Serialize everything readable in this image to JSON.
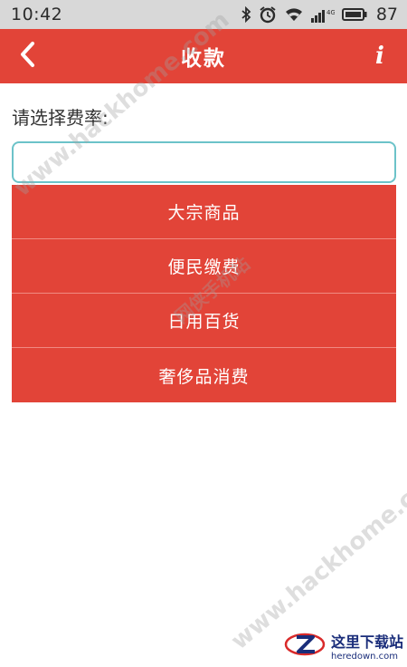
{
  "status_bar": {
    "time": "10:42",
    "network": "4G",
    "battery": "87",
    "icons": [
      "bluetooth-icon",
      "alarm-icon",
      "wifi-icon",
      "signal-icon",
      "battery-icon"
    ]
  },
  "header": {
    "title": "收款",
    "back_icon": "chevron-left-icon",
    "info_label": "i",
    "background": "#e24438"
  },
  "form": {
    "prompt": "请选择费率:",
    "input_value": "",
    "input_border_color": "#6cc3c9"
  },
  "dropdown": {
    "options": [
      {
        "label": "大宗商品"
      },
      {
        "label": "便民缴费"
      },
      {
        "label": "日用百货"
      },
      {
        "label": "奢侈品消费"
      }
    ]
  },
  "watermarks": {
    "site": "www.hackhome.com",
    "site_bottom": "www.hackhome.com",
    "cn": "网侠手机站"
  },
  "logo": {
    "title": "这里下载站",
    "subtitle": "heredown.com"
  }
}
